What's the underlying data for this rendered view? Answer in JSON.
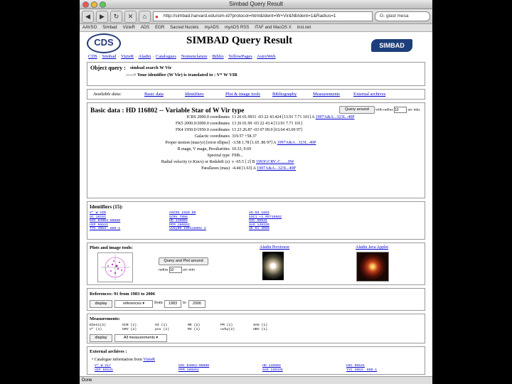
{
  "window": {
    "title": "Simbad Query Result"
  },
  "toolbar": {
    "url": "http://simbad.harvard.edu/sim-id?protocol=html&Ident=W+Vir&NbIdent=1&Radius=1",
    "search_value": "G- glast mesa"
  },
  "bookmarks": [
    "AAVSO",
    "Simbad",
    "VizieR",
    "ADS",
    "EGR",
    "Sacred Nucleis",
    "myADS",
    "myADS RSS",
    "ITAF and MacOS X",
    "inst.net"
  ],
  "header": {
    "title": "SIMBAD Query Result",
    "logo_left": "CDS",
    "logo_right": "SIMBAD"
  },
  "nav": [
    "CDS",
    "Simbad",
    "VizieR",
    "Aladin",
    "Catalogues",
    "Nomenclature",
    "Biblio",
    "YellowPages",
    "AstroWeb"
  ],
  "object_query": {
    "label": "Object query :",
    "query": "simbad search W Vir",
    "translated": "-----> Your identifier (W Vir) is translated to : V* W VIR"
  },
  "available": {
    "label": "Available data:",
    "links": [
      "Basic data",
      "Identifiers",
      "Plot & image tools",
      "Bibliography",
      "Measurements",
      "External archives"
    ]
  },
  "basic": {
    "title": "Basic data : HD 116802 -- Variable Star of W Vir type",
    "query_around": "Query around",
    "with_radius": "with radius",
    "radius_value": "10",
    "arcmin": "arc min.",
    "rows": [
      {
        "k": "ICRS 2000.0 coordinates",
        "v": "13 26 01.9931 -03 22 43.424 [13.91 7.71 101] A",
        "ref": "1997A&A...323L..49P"
      },
      {
        "k": "FK5 2000.0/2000.0 coordinates",
        "v": "13 26 01.99 -03 22 43.4 [13.91 7.71 101]",
        "ref": ""
      },
      {
        "k": "FK4 1950.0/1950.0 coordinates",
        "v": "13 23 26.87 -03 07 09.0 [63.64 43.69 97]",
        "ref": ""
      },
      {
        "k": "Galactic coordinates",
        "v": "319.57 +58.37",
        "ref": ""
      },
      {
        "k": "Proper motion (mas/yr) [error ellipse]",
        "v": "-3.58 1.78 [1.65 .86 97] A",
        "ref": "1997A&A...323L..49P"
      },
      {
        "k": "B magn, V magn, Peculiarities",
        "v": "10.33, 9.69",
        "ref": ""
      },
      {
        "k": "Spectral type",
        "v": "F0Ib...",
        "ref": ""
      },
      {
        "k": "Radial velocity (v:Km/s) or Redshift (z)",
        "v": "v -65.5 [ 2] B",
        "ref": "1993GCRV..C.......0W"
      },
      {
        "k": "Parallaxes (mas)",
        "v": "-4.44 [1.63] A",
        "ref": "1997A&A...323L..49P"
      }
    ]
  },
  "identifiers": {
    "heading": "Identifiers (15):",
    "items": [
      "V* W VIR",
      "ASCOS 1920.09",
      "AG-03 1693",
      "",
      "GC 18151",
      "GCRV 7956",
      "GSC1 +1 05716602",
      "",
      "GSC 04963-00880",
      "HD 116802",
      "HIC 65531",
      "",
      "HIP 65531",
      "PPM 196552",
      "SAO 139335",
      "",
      "TYC 4963- 880-1",
      "uvby98 100116802 V",
      "2E 51 4566",
      ""
    ]
  },
  "plots": {
    "heading": "Plots and image tools:",
    "query_plot": "Query and Plot around",
    "radius": "radius",
    "radius_value": "10",
    "arcmin": "arc min",
    "aladin_previewer": "Aladin Previewer",
    "aladin_applet": "Aladin Java Applet"
  },
  "references": {
    "heading": "References: 91 from 1983 to 2006",
    "display": "display",
    "select": "references",
    "from": "from",
    "from_value": "1983",
    "to": "to",
    "to_value": "2006"
  },
  "measurements": {
    "heading": "Measurements:",
    "items": [
      "Ebeni(2)",
      "GCR (1)",
      "HI (1)",
      "MK (2)",
      "PM (1)",
      "SAO (1)",
      "V* (1)",
      "GRV (2)",
      "pos (1)",
      "RV (1)",
      "uvby(2)",
      "UBV (1)"
    ],
    "display": "display",
    "select": "All measurements"
  },
  "external": {
    "heading": "External archives :",
    "catalogue": "Catalogue information from",
    "vizier": "VizieR",
    "items": [
      "V* W Vir",
      "GSC 04963-00880",
      "HD 116802",
      "HIC 65531",
      "HIP 65531",
      "PPM 196552",
      "SAO 139335",
      "TYC 4963- 880-1"
    ]
  },
  "status": "Done"
}
